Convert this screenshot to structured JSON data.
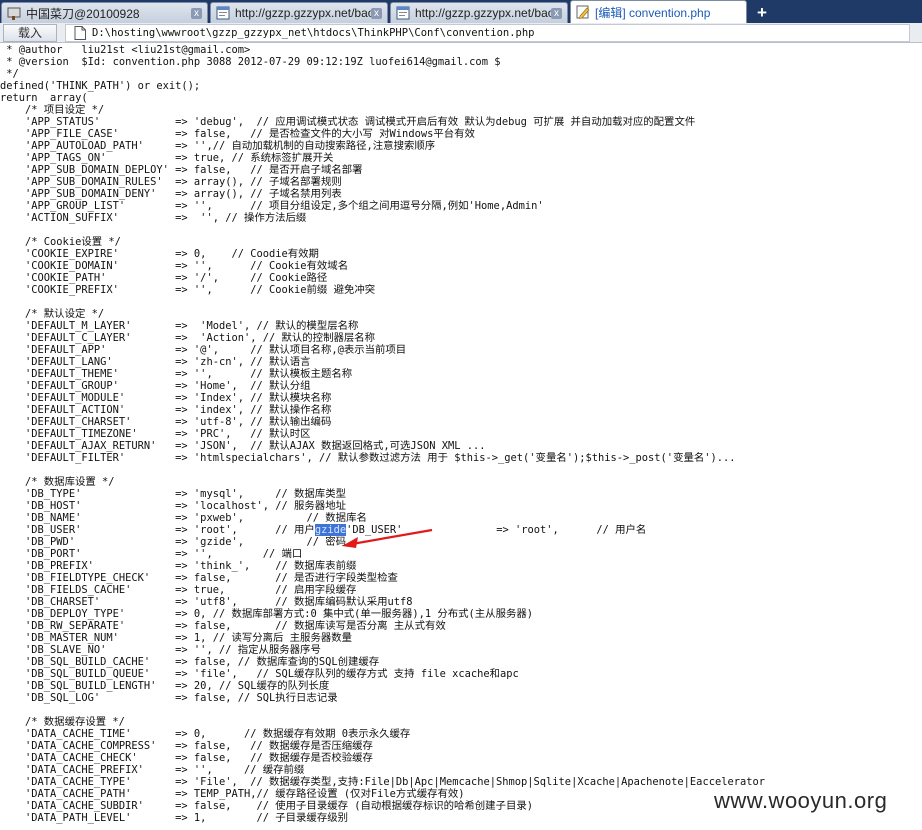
{
  "browser": {
    "tabs": [
      {
        "label": "中国菜刀@20100928",
        "icon": "cleaver-icon",
        "active": false,
        "width": 207
      },
      {
        "label": "http://gzzp.gzzypx.net/baoxin...",
        "icon": "page-icon",
        "active": false,
        "width": 178
      },
      {
        "label": "http://gzzp.gzzypx.net/baoxin...",
        "icon": "page-icon",
        "active": false,
        "width": 178
      },
      {
        "label": "[编辑] convention.php",
        "icon": "edit-icon",
        "active": true,
        "width": 177
      }
    ],
    "new_tab_label": "+",
    "close_label": "x",
    "load_button": "载入",
    "path": "D:\\hosting\\wwwroot\\gzzp_gzzypx_net\\htdocs\\ThinkPHP\\Conf\\convention.php"
  },
  "code": {
    "lines": [
      " * @author   liu21st <liu21st@gmail.com>",
      " * @version  $Id: convention.php 3088 2012-07-29 09:12:19Z luofei614@gmail.com $",
      " */",
      "defined('THINK_PATH') or exit();",
      "return  array(",
      "    /* 项目设定 */",
      "    'APP_STATUS'            => 'debug',  // 应用调试模式状态 调试模式开启后有效 默认为debug 可扩展 并自动加载对应的配置文件",
      "    'APP_FILE_CASE'         => false,   // 是否检查文件的大小写 对Windows平台有效",
      "    'APP_AUTOLOAD_PATH'     => '',// 自动加载机制的自动搜索路径,注意搜索顺序",
      "    'APP_TAGS_ON'           => true, // 系统标签扩展开关",
      "    'APP_SUB_DOMAIN_DEPLOY' => false,   // 是否开启子域名部署",
      "    'APP_SUB_DOMAIN_RULES'  => array(), // 子域名部署规则",
      "    'APP_SUB_DOMAIN_DENY'   => array(), // 子域名禁用列表",
      "    'APP_GROUP_LIST'        => '',      // 项目分组设定,多个组之间用逗号分隔,例如'Home,Admin'",
      "    'ACTION_SUFFIX'         =>  '', // 操作方法后缀",
      "",
      "    /* Cookie设置 */",
      "    'COOKIE_EXPIRE'         => 0,    // Coodie有效期",
      "    'COOKIE_DOMAIN'         => '',      // Cookie有效域名",
      "    'COOKIE_PATH'           => '/',     // Cookie路径",
      "    'COOKIE_PREFIX'         => '',      // Cookie前缀 避免冲突",
      "",
      "    /* 默认设定 */",
      "    'DEFAULT_M_LAYER'       =>  'Model', // 默认的模型层名称",
      "    'DEFAULT_C_LAYER'       =>  'Action', // 默认的控制器层名称",
      "    'DEFAULT_APP'           => '@',     // 默认项目名称,@表示当前项目",
      "    'DEFAULT_LANG'          => 'zh-cn', // 默认语言",
      "    'DEFAULT_THEME'         => '',      // 默认模板主题名称",
      "    'DEFAULT_GROUP'         => 'Home',  // 默认分组",
      "    'DEFAULT_MODULE'        => 'Index', // 默认模块名称",
      "    'DEFAULT_ACTION'        => 'index', // 默认操作名称",
      "    'DEFAULT_CHARSET'       => 'utf-8', // 默认输出编码",
      "    'DEFAULT_TIMEZONE'      => 'PRC',   // 默认时区",
      "    'DEFAULT_AJAX_RETURN'   => 'JSON',  // 默认AJAX 数据返回格式,可选JSON XML ...",
      "    'DEFAULT_FILTER'        => 'htmlspecialchars', // 默认参数过滤方法 用于 $this->_get('变量名');$this->_post('变量名')...",
      "",
      "    /* 数据库设置 */",
      "    'DB_TYPE'               => 'mysql',     // 数据库类型",
      "    'DB_HOST'               => 'localhost', // 服务器地址",
      "    'DB_NAME'               => 'pxweb',          // 数据库名",
      "    'DB_USER'               => 'root',      // 用户名",
      "    'DB_PWD'                => 'gzide',          // 密码",
      "    'DB_PORT'               => '',        // 端口",
      "    'DB_PREFIX'             => 'think_',    // 数据库表前缀",
      "    'DB_FIELDTYPE_CHECK'    => false,       // 是否进行字段类型检查",
      "    'DB_FIELDS_CACHE'       => true,        // 启用字段缓存",
      "    'DB_CHARSET'            => 'utf8',      // 数据库编码默认采用utf8",
      "    'DB_DEPLOY_TYPE'        => 0, // 数据库部署方式:0 集中式(单一服务器),1 分布式(主从服务器)",
      "    'DB_RW_SEPARATE'        => false,       // 数据库读写是否分离 主从式有效",
      "    'DB_MASTER_NUM'         => 1, // 读写分离后 主服务器数量",
      "    'DB_SLAVE_NO'           => '', // 指定从服务器序号",
      "    'DB_SQL_BUILD_CACHE'    => false, // 数据库查询的SQL创建缓存",
      "    'DB_SQL_BUILD_QUEUE'    => 'file',   // SQL缓存队列的缓存方式 支持 file xcache和apc",
      "    'DB_SQL_BUILD_LENGTH'   => 20, // SQL缓存的队列长度",
      "    'DB_SQL_LOG'            => false, // SQL执行日志记录",
      "",
      "    /* 数据缓存设置 */",
      "    'DATA_CACHE_TIME'       => 0,      // 数据缓存有效期 0表示永久缓存",
      "    'DATA_CACHE_COMPRESS'   => false,   // 数据缓存是否压缩缓存",
      "    'DATA_CACHE_CHECK'      => false,   // 数据缓存是否校验缓存",
      "    'DATA_CACHE_PREFIX'     => '',     // 缓存前缀",
      "    'DATA_CACHE_TYPE'       => 'File',  // 数据缓存类型,支持:File|Db|Apc|Memcache|Shmop|Sqlite|Xcache|Apachenote|Eaccelerator",
      "    'DATA_CACHE_PATH'       => TEMP_PATH,// 缓存路径设置 (仅对File方式缓存有效)",
      "    'DATA_CACHE_SUBDIR'     => false,    // 使用子目录缓存 (自动根据缓存标识的哈希创建子目录)",
      "    'DATA_PATH_LEVEL'       => 1,        // 子目录缓存级别"
    ],
    "highlight": {
      "line": 40,
      "text": "gzide"
    }
  },
  "watermark": "www.wooyun.org",
  "colors": {
    "tabbar": "#1f3a66",
    "selection": "#3d74d6",
    "arrow": "#e11b1b"
  }
}
